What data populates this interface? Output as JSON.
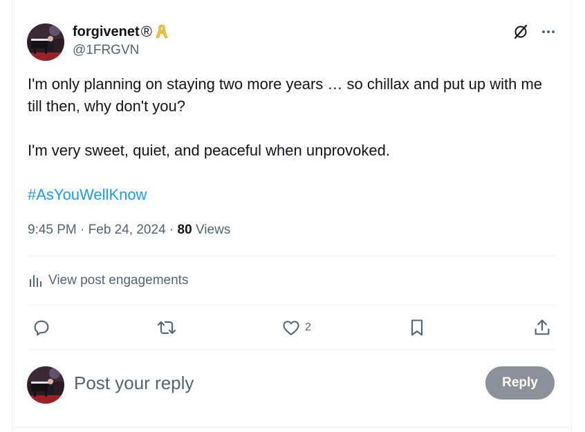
{
  "tweet": {
    "author": {
      "display_name": "forgivenet",
      "registered_mark": "®",
      "handle": "@1FRGVN"
    },
    "text_lines": [
      "I'm only planning on staying two more years … so chillax and put up with me till then, why don't you?",
      "I'm very sweet, quiet, and peaceful when unprovoked."
    ],
    "hashtag": "#AsYouWellKnow",
    "time": "9:45 PM",
    "separator": " · ",
    "date": "Feb 24, 2024",
    "views_count": "80",
    "views_label": " Views"
  },
  "engagements": {
    "label": "View post engagements"
  },
  "actions": {
    "like_count": "2"
  },
  "reply": {
    "placeholder": "Post your reply",
    "button_label": "Reply"
  },
  "colors": {
    "accent": "#1d9bf0",
    "muted_text": "#536471",
    "text": "#0f1419",
    "reply_button": "#8b9196",
    "ribbon": "#f4c542"
  },
  "icons": [
    "grok-icon",
    "more-icon",
    "analytics-icon",
    "reply-icon",
    "retweet-icon",
    "like-icon",
    "bookmark-icon",
    "share-icon",
    "awareness-ribbon-icon"
  ]
}
